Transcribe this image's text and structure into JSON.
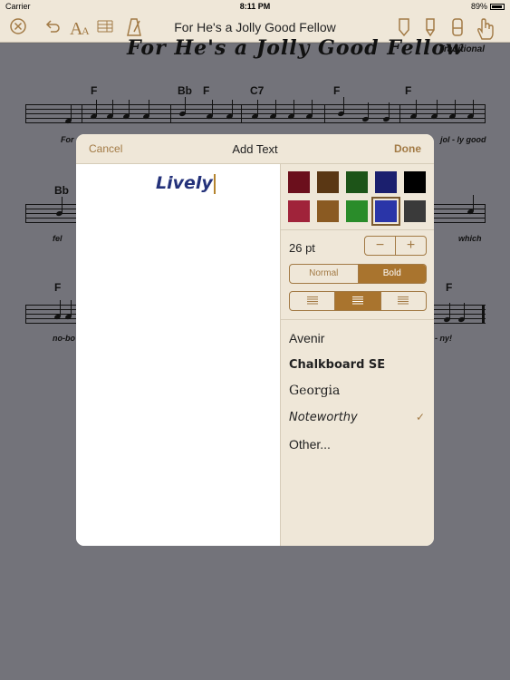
{
  "status_bar": {
    "carrier": "Carrier",
    "time": "8:11 PM",
    "battery": "89%"
  },
  "toolbar": {
    "title": "For He's a Jolly Good Fellow",
    "icons": [
      "close-icon",
      "undo-icon",
      "text-size-icon",
      "measure-icon",
      "metronome-icon",
      "marker-icon",
      "pen-icon",
      "eraser-icon",
      "hand-icon"
    ]
  },
  "sheet": {
    "heading": "For He's a Jolly Good Fellow",
    "composer": "Traditional",
    "chords_row1": [
      "F",
      "Bb",
      "F",
      "C7",
      "F",
      "F"
    ],
    "chords_row2": [
      "Bb"
    ],
    "chords_row3": [
      "F",
      "F"
    ],
    "lyrics_row1": [
      "For",
      "jol - ly good"
    ],
    "lyrics_row2": [
      "fel",
      "which"
    ],
    "lyrics_row3": [
      "no-bo",
      "- ny!"
    ]
  },
  "dialog": {
    "cancel_label": "Cancel",
    "title": "Add Text",
    "done_label": "Done",
    "text_value": "Lively",
    "colors": [
      "#6b0f1c",
      "#5a3714",
      "#1d5418",
      "#1b1f6e",
      "#000000",
      "#a0233a",
      "#8a5a22",
      "#2a8c2a",
      "#2a35a8",
      "#3a3a3a"
    ],
    "selected_color_index": 8,
    "size_label": "26 pt",
    "minus_label": "−",
    "plus_label": "+",
    "weight_options": [
      "Normal",
      "Bold"
    ],
    "selected_weight": "Bold",
    "alignments": [
      "align-left-icon",
      "align-center-icon",
      "align-right-icon"
    ],
    "selected_alignment": "align-center-icon",
    "fonts": [
      "Avenir",
      "Chalkboard SE",
      "Georgia",
      "Noteworthy",
      "Other..."
    ],
    "selected_font": "Noteworthy",
    "check_mark": "✓"
  }
}
